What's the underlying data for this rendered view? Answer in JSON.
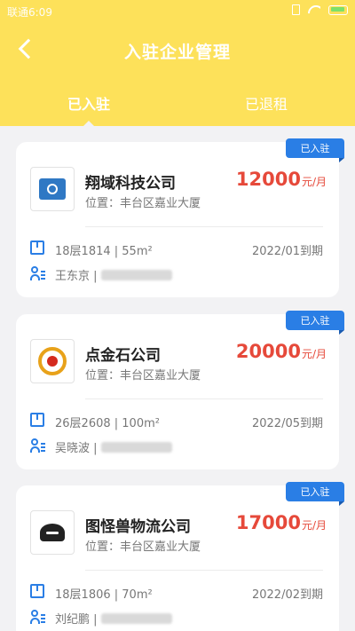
{
  "status_bar": {
    "carrier": "联通6:09"
  },
  "header": {
    "title": "入驻企业管理"
  },
  "tabs": [
    {
      "label": "已入驻",
      "active": true
    },
    {
      "label": "已退租",
      "active": false
    }
  ],
  "theme": {
    "header_bg": "#fde15a",
    "badge": "#2a7ee5",
    "price": "#e6493a"
  },
  "cards": [
    {
      "badge": "已入驻",
      "company": "翔域科技公司",
      "address": "位置：丰台区嘉业大厦",
      "price": "12000",
      "price_unit": "元/月",
      "room": "18层1814 | 55m²",
      "expiry": "2022/01到期",
      "contact": "王东京 |"
    },
    {
      "badge": "已入驻",
      "company": "点金石公司",
      "address": "位置：丰台区嘉业大厦",
      "price": "20000",
      "price_unit": "元/月",
      "room": "26层2608 | 100m²",
      "expiry": "2022/05到期",
      "contact": "吴晓波 |"
    },
    {
      "badge": "已入驻",
      "company": "图怪兽物流公司",
      "address": "位置：丰台区嘉业大厦",
      "price": "17000",
      "price_unit": "元/月",
      "room": "18层1806 | 70m²",
      "expiry": "2022/02到期",
      "contact": "刘纪鹏 |"
    }
  ]
}
